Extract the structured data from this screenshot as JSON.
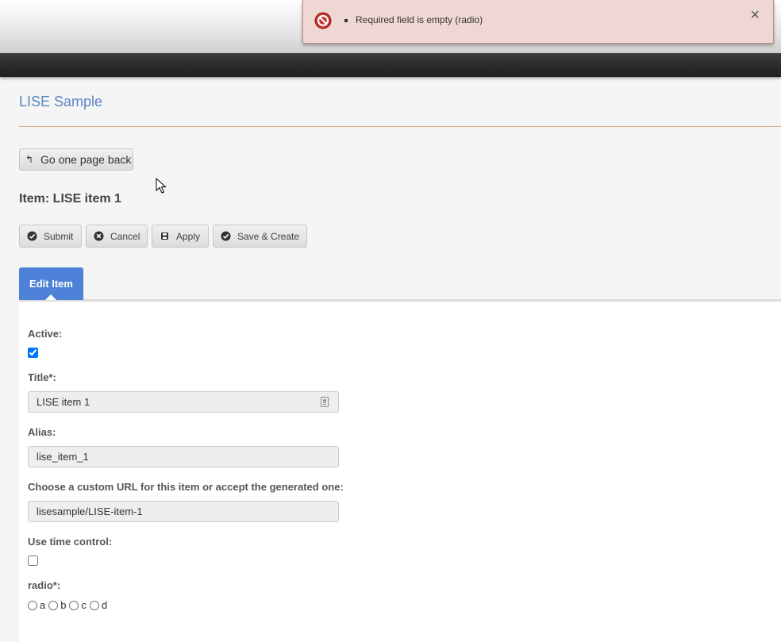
{
  "alert": {
    "messages": [
      "Required field is empty (radio)"
    ],
    "close": "×",
    "color": "#efd8d3",
    "icon": "stop-icon"
  },
  "page": {
    "title": "LISE Sample",
    "back_button": "Go one page back",
    "item_heading": "Item: LISE item 1"
  },
  "actions": {
    "submit": "Submit",
    "cancel": "Cancel",
    "apply": "Apply",
    "save_create": "Save & Create"
  },
  "tabs": [
    {
      "label": "Edit Item",
      "active": true
    }
  ],
  "form": {
    "active": {
      "label": "Active:",
      "checked": true
    },
    "title": {
      "label": "Title*:",
      "value": "LISE item 1"
    },
    "alias": {
      "label": "Alias:",
      "value": "lise_item_1"
    },
    "url": {
      "label": "Choose a custom URL for this item or accept the generated one:",
      "value": "lisesample/LISE-item-1"
    },
    "time_control": {
      "label": "Use time control:",
      "checked": false
    },
    "radio": {
      "label": "radio*:",
      "options": [
        "a",
        "b",
        "c",
        "d"
      ],
      "selected": null
    }
  },
  "colors": {
    "accent": "#4d82d8",
    "title": "#5b86c5",
    "divider": "#d9a37a",
    "navbar": "#2a2a2a"
  }
}
